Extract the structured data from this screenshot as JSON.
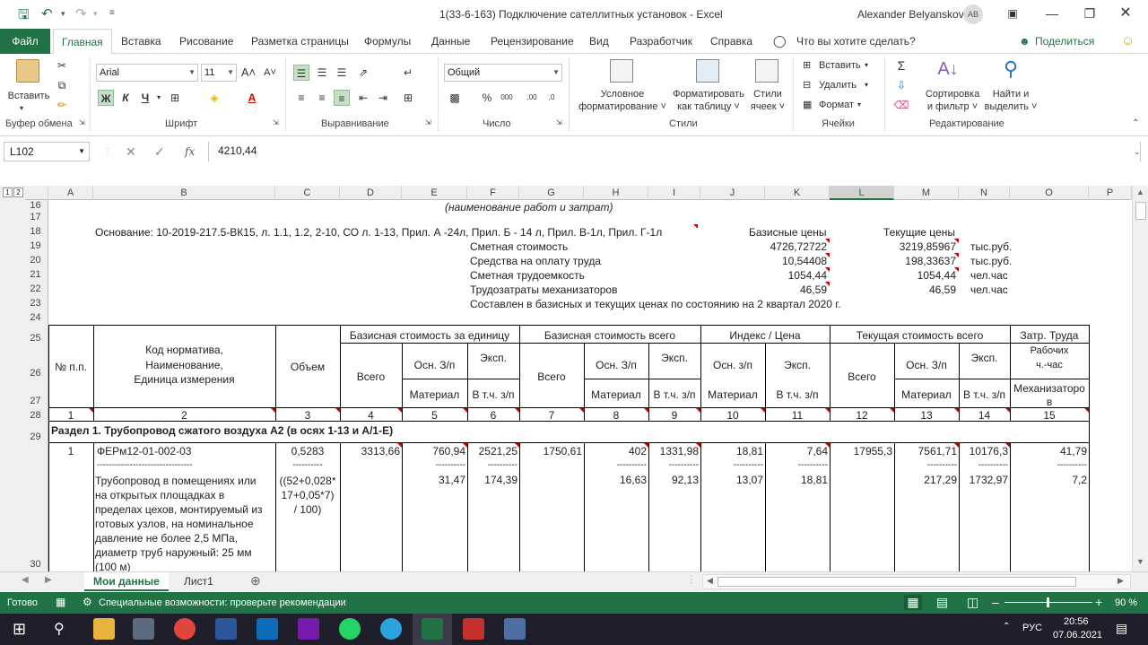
{
  "window": {
    "title": "1(33-6-163) Подключение сателлитных установок  -  Excel",
    "user": "Alexander Belyanskov",
    "avatar": "AB"
  },
  "menu": {
    "file": "Файл",
    "tabs": [
      "Главная",
      "Вставка",
      "Рисование",
      "Разметка страницы",
      "Формулы",
      "Данные",
      "Рецензирование",
      "Вид",
      "Разработчик",
      "Справка"
    ],
    "tell_me": "Что вы хотите сделать?",
    "share": "Поделиться"
  },
  "ribbon": {
    "paste": "Вставить",
    "font_name": "Arial",
    "font_size": "11",
    "number_format": "Общий",
    "conditional": [
      "Условное",
      "форматирование"
    ],
    "format_table": [
      "Форматировать",
      "как таблицу"
    ],
    "styles_btn": [
      "Стили",
      "ячеек"
    ],
    "insert": "Вставить",
    "delete": "Удалить",
    "format": "Формат",
    "sort": [
      "Сортировка",
      "и фильтр"
    ],
    "find": [
      "Найти и",
      "выделить"
    ],
    "groups": [
      "Буфер обмена",
      "Шрифт",
      "Выравнивание",
      "Число",
      "Стили",
      "Ячейки",
      "Редактирование"
    ]
  },
  "formula_bar": {
    "name_box": "L102",
    "fx": "fx",
    "value": "4210,44"
  },
  "columns": [
    "A",
    "B",
    "C",
    "D",
    "E",
    "F",
    "G",
    "H",
    "I",
    "J",
    "K",
    "L",
    "M",
    "N",
    "O",
    "P"
  ],
  "rows": [
    "16",
    "17",
    "18",
    "19",
    "20",
    "21",
    "22",
    "23",
    "24",
    "25",
    "26",
    "27",
    "28",
    "29",
    "30"
  ],
  "sheet": {
    "r16": "(наименование работ и затрат)",
    "r18_basis": "Основание: 10-2019-217.5-ВК15, л. 1.1, 1.2, 2-10, СО л. 1-13, Прил. А -24л, Прил. Б - 14 л, Прил. В-1л, Прил. Г-1л",
    "base_prices": "Базисные цены",
    "cur_prices": "Текущие цены",
    "summary": [
      {
        "label": "Сметная стоимость",
        "base": "4726,72722",
        "cur": "3219,85967",
        "unit": "тыс.руб."
      },
      {
        "label": "Средства на оплату труда",
        "base": "10,54408",
        "cur": "198,33637",
        "unit": "тыс.руб."
      },
      {
        "label": "Сметная трудоемкость",
        "base": "1054,44",
        "cur": "1054,44",
        "unit": "чел.час"
      },
      {
        "label": "Трудозатраты механизаторов",
        "base": "46,59",
        "cur": "46,59",
        "unit": "чел.час"
      }
    ],
    "r23": "Составлен в базисных и текущих ценах по состоянию на 2 квартал 2020 г.",
    "hdr": {
      "num": "№ п.п.",
      "code": [
        "Код норматива,",
        "Наименование,",
        "Единица измерения"
      ],
      "vol": "Объем",
      "base_unit": "Базисная стоимость за единицу",
      "base_total": "Базисная стоимость всего",
      "index": "Индекс / Цена",
      "cur_total": "Текущая стоимость всего",
      "labor": "Затр. Труда",
      "all": "Всего",
      "osn": "Осн. З/п",
      "osn_l": "Осн. з/п",
      "eksp": "Эксп.",
      "mat": "Материал",
      "vtch": "В т.ч. з/п",
      "workers": [
        "Рабочих",
        "ч.-час"
      ],
      "mech": [
        "Механизаторо",
        "в"
      ]
    },
    "colnums": [
      "1",
      "2",
      "3",
      "4",
      "5",
      "6",
      "7",
      "8",
      "9",
      "10",
      "11",
      "12",
      "13",
      "14",
      "15"
    ],
    "section": "Раздел 1. Трубопровод сжатого воздуха А2 (в осях 1-13  и А/1-Е)",
    "item": {
      "num": "1",
      "code": "ФЕРм12-01-002-03",
      "dashes": "--------------------------------",
      "desc": [
        "Трубопровод в помещениях или",
        "на открытых площадках в",
        "пределах цехов, монтируемый из",
        "готовых узлов, на номинальное",
        "давление не более 2,5 МПа,",
        "диаметр труб наружный: 25 мм",
        "(100 м)"
      ],
      "vol": "0,5283",
      "vol_dash": "----------",
      "vol_formula": [
        "((52+0,028*",
        "17+0,05*7)",
        "/ 100)"
      ],
      "top": [
        "3313,66",
        "760,94",
        "2521,25",
        "1750,61",
        "402",
        "1331,98",
        "18,81",
        "7,64",
        "17955,3",
        "7561,71",
        "10176,3",
        "41,79"
      ],
      "bottom": [
        "31,47",
        "174,39",
        "16,63",
        "92,13",
        "13,07",
        "18,81",
        "217,29",
        "1732,97",
        "7,2"
      ],
      "dash": "----------"
    }
  },
  "sheet_tabs": [
    "Мои данные",
    "Лист1"
  ],
  "status": {
    "ready": "Готово",
    "accessibility": "Специальные возможности: проверьте рекомендации",
    "zoom": "90 %"
  },
  "taskbar": {
    "lang": "РУС",
    "time": "20:56",
    "date": "07.06.2021"
  }
}
